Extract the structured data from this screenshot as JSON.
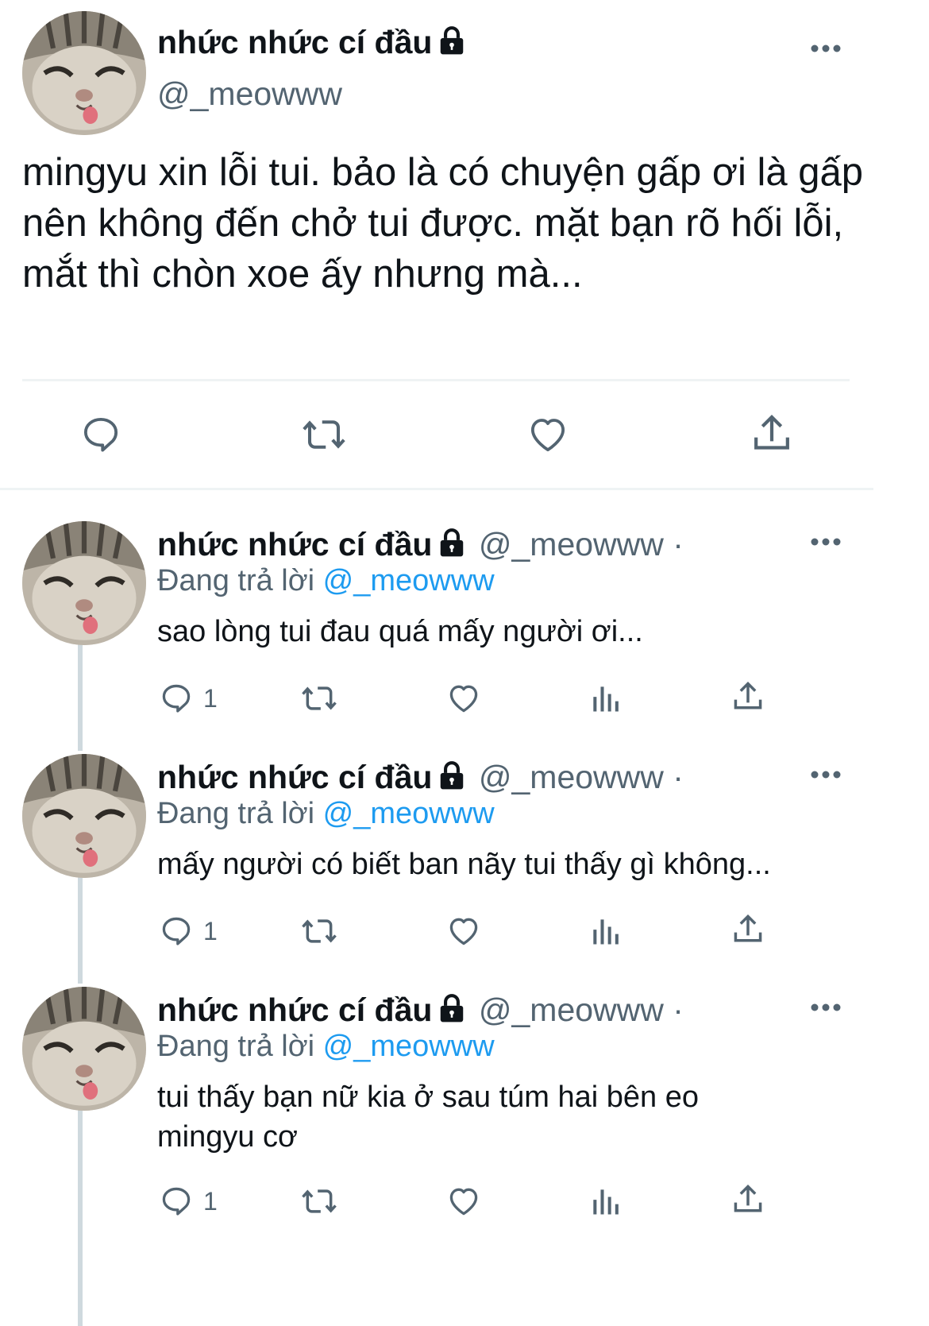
{
  "main_tweet": {
    "display_name": "nhức nhức cí đầu",
    "handle": "@_meowww",
    "text": "mingyu xin lỗi tui. bảo là có chuyện gấp ơi là gấp nên không đến chở tui được. mặt bạn rõ hối lỗi, mắt thì chòn xoe ấy nhưng mà..."
  },
  "replies": [
    {
      "display_name": "nhức nhức cí đầu",
      "handle": "@_meowww ·",
      "replying_label": "Đang trả lời",
      "replying_to": "@_meowww",
      "text": "sao lòng tui đau quá mấy người ơi...",
      "reply_count": "1"
    },
    {
      "display_name": "nhức nhức cí đầu",
      "handle": "@_meowww ·",
      "replying_label": "Đang trả lời",
      "replying_to": "@_meowww",
      "text": "mấy người có biết ban nãy tui thấy gì không...",
      "reply_count": "1"
    },
    {
      "display_name": "nhức nhức cí đầu",
      "handle": "@_meowww ·",
      "replying_label": "Đang trả lời",
      "replying_to": "@_meowww",
      "text": "tui thấy bạn nữ kia ở sau túm hai bên eo mingyu cơ",
      "reply_count": "1"
    }
  ],
  "icons": {
    "reply": "reply-icon",
    "retweet": "retweet-icon",
    "like": "heart-icon",
    "views": "views-icon",
    "share": "share-icon",
    "more": "more-icon",
    "lock": "lock-icon"
  },
  "colors": {
    "text": "#0f1419",
    "secondary": "#536471",
    "mention": "#1d9bf0",
    "divider": "#eff3f4"
  }
}
